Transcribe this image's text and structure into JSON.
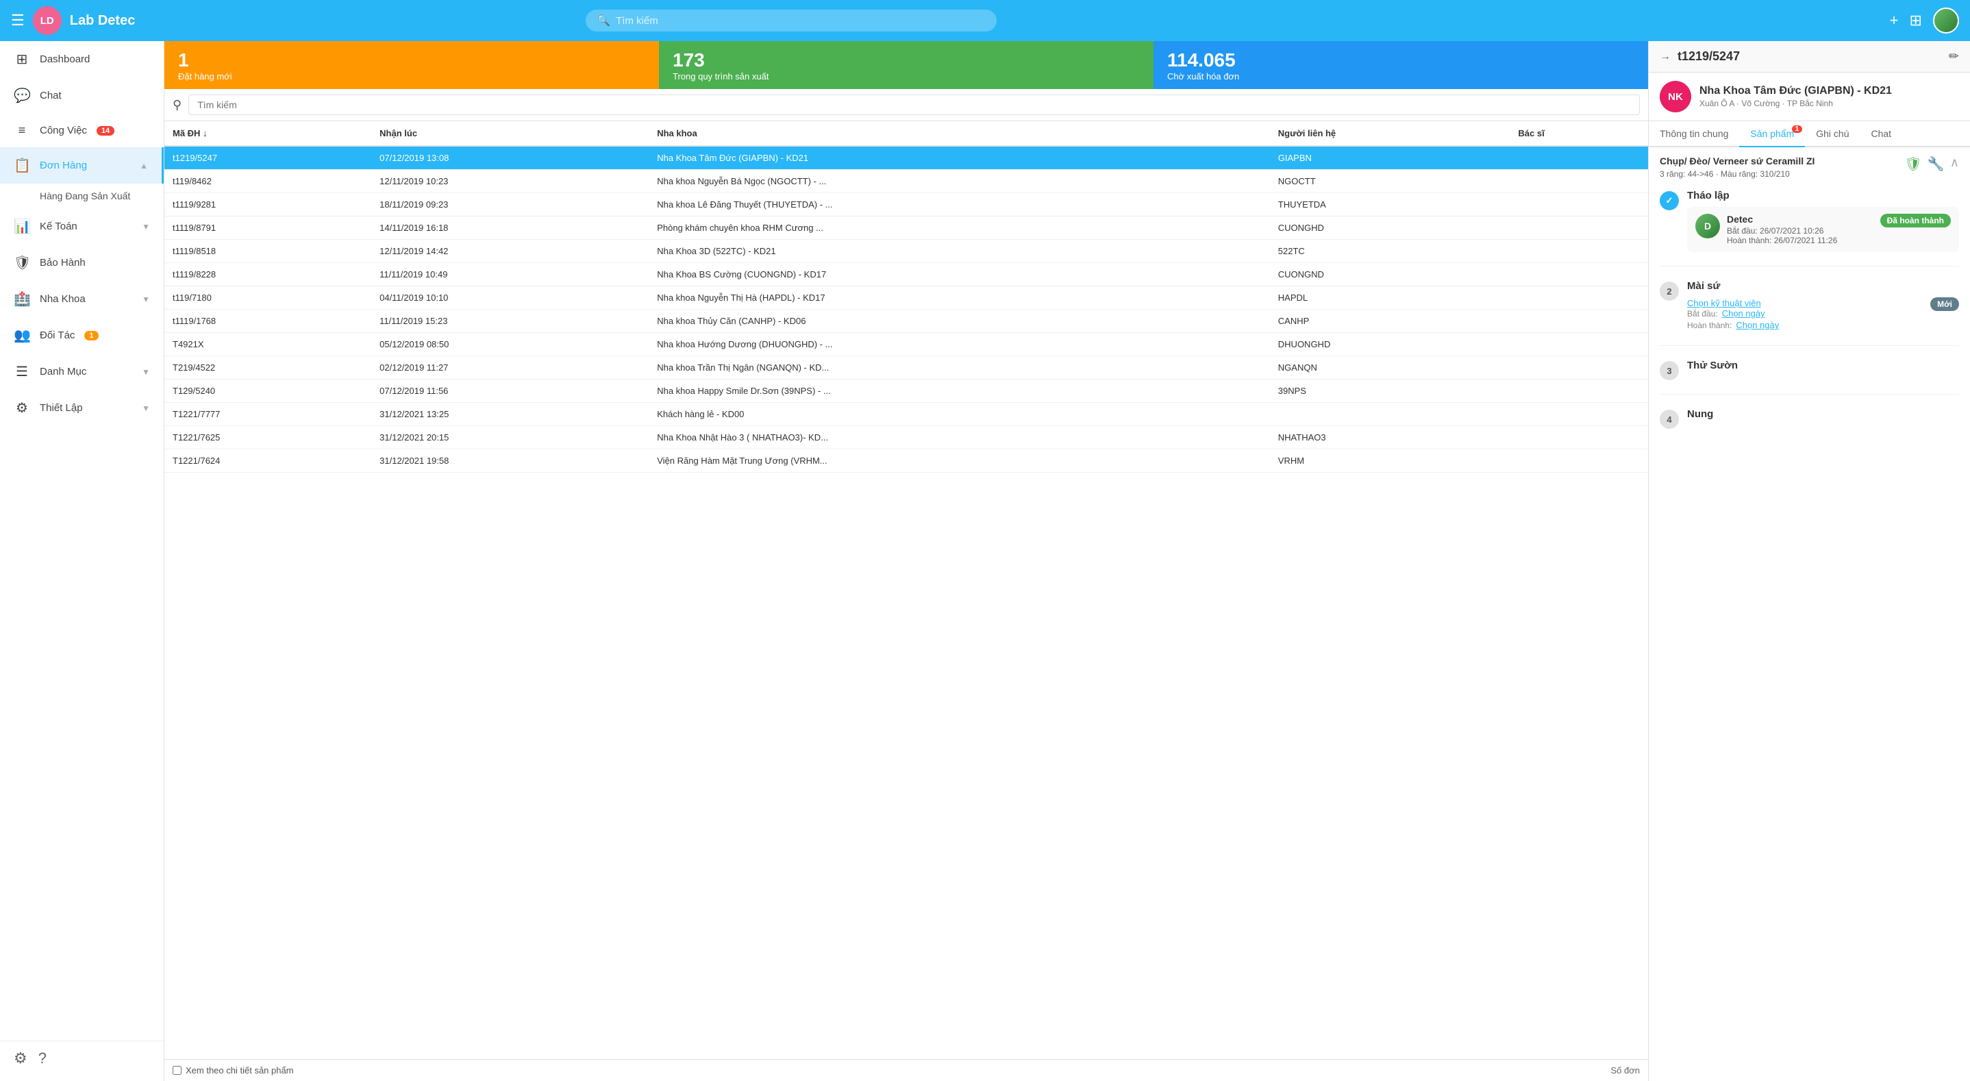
{
  "header": {
    "app_name": "Lab Detec",
    "avatar_initials": "LD",
    "search_placeholder": "Tìm kiếm",
    "add_icon": "+",
    "qr_icon": "⊞"
  },
  "sidebar": {
    "items": [
      {
        "id": "dashboard",
        "label": "Dashboard",
        "icon": "⊞",
        "badge": null,
        "active": false
      },
      {
        "id": "chat",
        "label": "Chat",
        "icon": "💬",
        "badge": null,
        "active": false
      },
      {
        "id": "cong-viec",
        "label": "Công Việc",
        "icon": "≡",
        "badge": "14",
        "active": false
      },
      {
        "id": "don-hang",
        "label": "Đơn Hàng",
        "icon": "📋",
        "badge": null,
        "active": true,
        "expanded": true
      },
      {
        "id": "hang-dang-sx",
        "label": "Hàng Đang Sản Xuất",
        "sub": true,
        "active": false
      },
      {
        "id": "ke-toan",
        "label": "Kế Toán",
        "icon": "📊",
        "badge": null,
        "active": false,
        "arrow": true
      },
      {
        "id": "bao-hanh",
        "label": "Bảo Hành",
        "icon": "🛡",
        "badge": null,
        "active": false
      },
      {
        "id": "nha-khoa",
        "label": "Nha Khoa",
        "icon": "🏥",
        "badge": null,
        "active": false,
        "arrow": true
      },
      {
        "id": "doi-tac",
        "label": "Đối Tác",
        "icon": "👥",
        "badge": "1",
        "badge_color": "orange",
        "active": false
      },
      {
        "id": "danh-muc",
        "label": "Danh Mục",
        "icon": "☰",
        "badge": null,
        "active": false,
        "arrow": true
      },
      {
        "id": "thiet-lap",
        "label": "Thiết Lập",
        "icon": "⚙",
        "badge": null,
        "active": false,
        "arrow": true
      }
    ],
    "bottom_icons": [
      "⚙",
      "?"
    ]
  },
  "stats": [
    {
      "number": "1",
      "label": "Đặt hàng mới",
      "color": "orange"
    },
    {
      "number": "173",
      "label": "Trong quy trình sản xuất",
      "color": "green"
    },
    {
      "number": "114.065",
      "label": "Chờ xuất hóa đơn",
      "color": "blue"
    }
  ],
  "table": {
    "filter_placeholder": "Tìm kiếm",
    "columns": [
      "Mã ĐH ↓",
      "Nhận lúc",
      "Nha khoa",
      "Người liên hệ",
      "Bác sĩ"
    ],
    "rows": [
      {
        "id": "t1219/5247",
        "date": "07/12/2019 13:08",
        "clinic": "Nha Khoa Tâm Đức (GIAPBN) - KD21",
        "contact": "GIAPBN",
        "selected": true
      },
      {
        "id": "t119/8462",
        "date": "12/11/2019 10:23",
        "clinic": "Nha khoa Nguyễn Bá Ngọc (NGOCTT) - ...",
        "contact": "NGOCTT",
        "selected": false
      },
      {
        "id": "t1119/9281",
        "date": "18/11/2019 09:23",
        "clinic": "Nha khoa Lê Đăng Thuyết (THUYETDA) - ...",
        "contact": "THUYETDA",
        "selected": false
      },
      {
        "id": "t1119/8791",
        "date": "14/11/2019 16:18",
        "clinic": "Phòng khám chuyên khoa RHM Cương ...",
        "contact": "CUONGHD",
        "selected": false
      },
      {
        "id": "t1119/8518",
        "date": "12/11/2019 14:42",
        "clinic": "Nha Khoa 3D (522TC) - KD21",
        "contact": "522TC",
        "selected": false
      },
      {
        "id": "t1119/8228",
        "date": "11/11/2019 10:49",
        "clinic": "Nha Khoa BS Cường (CUONGND) - KD17",
        "contact": "CUONGND",
        "selected": false
      },
      {
        "id": "t119/7180",
        "date": "04/11/2019 10:10",
        "clinic": "Nha khoa Nguyễn Thị Hà (HAPDL) - KD17",
        "contact": "HAPDL",
        "selected": false
      },
      {
        "id": "t1119/1768",
        "date": "11/11/2019 15:23",
        "clinic": "Nha khoa Thủy Căn (CANHP) - KD06",
        "contact": "CANHP",
        "selected": false
      },
      {
        "id": "T4921X",
        "date": "05/12/2019 08:50",
        "clinic": "Nha khoa Hướng Dương (DHUONGHD) - ...",
        "contact": "DHUONGHD",
        "selected": false
      },
      {
        "id": "T219/4522",
        "date": "02/12/2019 11:27",
        "clinic": "Nha khoa Trần Thị Ngân (NGANQN) - KD...",
        "contact": "NGANQN",
        "selected": false
      },
      {
        "id": "T129/5240",
        "date": "07/12/2019 11:56",
        "clinic": "Nha khoa Happy Smile Dr.Sơn (39NPS) - ...",
        "contact": "39NPS",
        "selected": false
      },
      {
        "id": "T1221/7777",
        "date": "31/12/2021 13:25",
        "clinic": "Khách hàng lẻ - KD00",
        "contact": "",
        "selected": false
      },
      {
        "id": "T1221/7625",
        "date": "31/12/2021 20:15",
        "clinic": "Nha Khoa Nhật Hào 3 ( NHATHAO3)- KD...",
        "contact": "NHATHAO3",
        "selected": false
      },
      {
        "id": "T1221/7624",
        "date": "31/12/2021 19:58",
        "clinic": "Viện Răng Hàm Mặt Trung Ương (VRHM...",
        "contact": "VRHM",
        "selected": false
      }
    ],
    "footer_label": "Xem theo chi tiết sản phẩm",
    "footer_right": "Số đơn"
  },
  "right_panel": {
    "order_id": "t1219/5247",
    "clinic_avatar": "NK",
    "clinic_name": "Nha Khoa Tâm Đức (GIAPBN) - KD21",
    "clinic_address": "Xuân Ô A · Võ Cường · TP Bắc Ninh",
    "tabs": [
      {
        "id": "thong-tin-chung",
        "label": "Thông tin chung",
        "badge": null
      },
      {
        "id": "san-pham",
        "label": "Sản phẩm",
        "badge": "1"
      },
      {
        "id": "ghi-chu",
        "label": "Ghi chú",
        "badge": null
      },
      {
        "id": "chat",
        "label": "Chat",
        "badge": null
      }
    ],
    "active_tab": "san-pham",
    "product": {
      "name": "Chụp/ Đèo/ Verneer sứ Ceramill ZI",
      "detail": "3 răng: 44->46 · Màu răng: 310/210"
    },
    "steps": [
      {
        "number": 1,
        "done": true,
        "title": "Tháo lập",
        "card": {
          "avatar_text": "D",
          "name": "Detec",
          "meta1_label": "Bắt đầu: 26/07/2021 10:26",
          "meta2_label": "Hoàn thành: 26/07/2021 11:26",
          "status": "Đã hoàn thành",
          "status_type": "done"
        }
      },
      {
        "number": 2,
        "done": false,
        "title": "Mài sứ",
        "card": {
          "avatar_text": null,
          "link_text": "Chọn kỹ thuật viên",
          "start_label": "Bắt đầu:",
          "start_link": "Chọn ngày",
          "end_label": "Hoàn thành:",
          "end_link": "Chọn ngày",
          "status": "Mới",
          "status_type": "new"
        }
      },
      {
        "number": 3,
        "done": false,
        "title": "Thử Sườn",
        "card": null
      },
      {
        "number": 4,
        "done": false,
        "title": "Nung",
        "card": null
      }
    ]
  }
}
